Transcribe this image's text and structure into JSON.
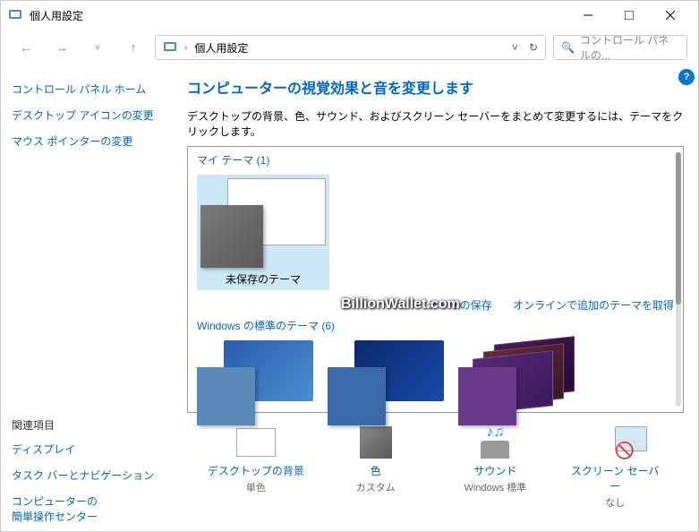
{
  "titlebar": {
    "title": "個人用設定"
  },
  "nav": {
    "breadcrumb": "個人用設定",
    "search_placeholder": "コントロール パネルの..."
  },
  "sidebar": {
    "links": [
      "コントロール パネル ホーム",
      "デスクトップ アイコンの変更",
      "マウス ポインターの変更"
    ],
    "related_label": "関連項目",
    "related": [
      "ディスプレイ",
      "タスク バーとナビゲーション",
      "コンピューターの\n簡単操作センター"
    ]
  },
  "main": {
    "title": "コンピューターの視覚効果と音を変更します",
    "desc": "デスクトップの背景、色、サウンド、およびスクリーン セーバーをまとめて変更するには、テーマをクリックします。",
    "my_themes_label": "マイ テーマ (1)",
    "unsaved_theme": "未保存のテーマ",
    "save_link": "テーマの保存",
    "online_link": "オンラインで追加のテーマを取得",
    "default_label": "Windows の標準のテーマ (6)"
  },
  "bottom": {
    "items": [
      {
        "label": "デスクトップの背景",
        "value": "単色"
      },
      {
        "label": "色",
        "value": "カスタム"
      },
      {
        "label": "サウンド",
        "value": "Windows 標準"
      },
      {
        "label": "スクリーン セーバー",
        "value": "なし"
      }
    ]
  },
  "watermark": "BillionWallet.com"
}
